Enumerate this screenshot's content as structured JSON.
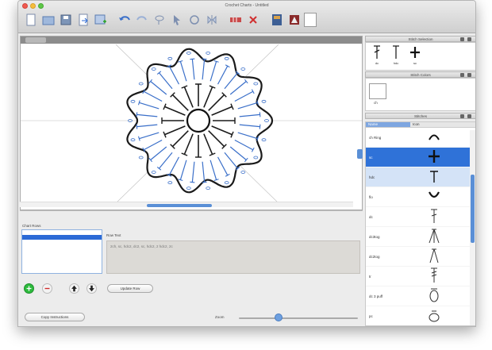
{
  "window": {
    "title": "Crochet Charts - Untitled"
  },
  "toolbar": {
    "icons": [
      "new-doc-icon",
      "open-icon",
      "save-icon",
      "export-icon",
      "add-image-icon",
      "undo-icon",
      "redo-icon",
      "lasso-icon",
      "select-icon",
      "rotate-icon",
      "mirror-icon",
      "grid-icon",
      "delete-icon",
      "stitch-library-icon",
      "color-icon",
      "color-swatch-icon"
    ]
  },
  "bottom": {
    "rows_label": "Chart Rows",
    "row_items": [
      "",
      ""
    ],
    "row_text_label": "Row Text",
    "row_text": "2ch, sc, hdc2, dc2, sc, hdc2, 2 hdc2, 2c",
    "update_row_label": "Update Row",
    "copy_instructions_label": "Copy Instructions",
    "zoom_label": "Zoom"
  },
  "panels": {
    "stitch_selection_title": "Stitch Selection",
    "stitch_colors_title": "Stitch Colors",
    "stitches_title": "Stitches",
    "selection_labels": [
      "dc",
      "hdc",
      "sc"
    ],
    "color_label": "ch",
    "list_headers": [
      "Name",
      "Icon"
    ],
    "stitch_rows": [
      {
        "name": "ch Ring",
        "icon": "arc-icon",
        "state": "normal"
      },
      {
        "name": "sc",
        "icon": "plus-icon",
        "state": "selected"
      },
      {
        "name": "hdc",
        "icon": "tee-icon",
        "state": "highlight"
      },
      {
        "name": "flo",
        "icon": "curve-icon",
        "state": "normal"
      },
      {
        "name": "dc",
        "icon": "dc-icon",
        "state": "normal"
      },
      {
        "name": "dc3tog",
        "icon": "dc3tog-icon",
        "state": "normal"
      },
      {
        "name": "dc2tog",
        "icon": "dc2tog-icon",
        "state": "normal"
      },
      {
        "name": "tr",
        "icon": "tr-icon",
        "state": "normal"
      },
      {
        "name": "dc 3 puff",
        "icon": "puff-icon",
        "state": "normal"
      },
      {
        "name": "pc",
        "icon": "popcorn-icon",
        "state": "normal"
      }
    ]
  },
  "colors": {
    "accent": "#2f72d8",
    "stitch_blue": "#3a6fc9",
    "stitch_black": "#1a1a1a"
  }
}
